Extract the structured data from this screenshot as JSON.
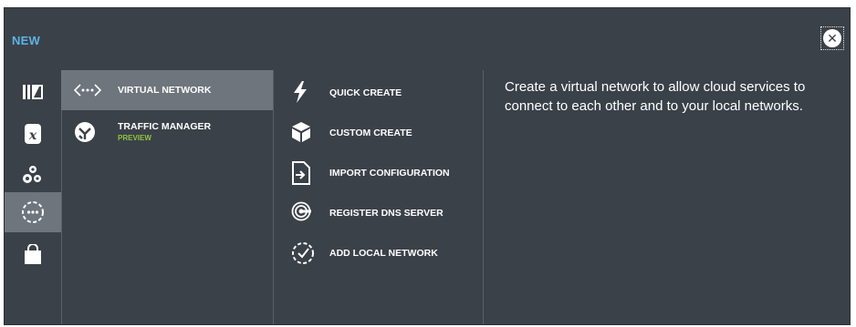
{
  "dialog": {
    "title": "NEW",
    "close_icon": "close-icon",
    "description": "Create a virtual network to allow cloud services to connect to each other and to your local networks."
  },
  "rail": {
    "items": [
      {
        "icon": "sql-database-icon"
      },
      {
        "icon": "storage-table-icon"
      },
      {
        "icon": "gears-icon"
      },
      {
        "icon": "network-services-icon",
        "selected": true
      },
      {
        "icon": "store-bag-icon"
      }
    ]
  },
  "services": [
    {
      "label": "VIRTUAL NETWORK",
      "icon": "virtual-network-icon",
      "selected": true
    },
    {
      "label": "TRAFFIC MANAGER",
      "sublabel": "PREVIEW",
      "icon": "traffic-manager-icon"
    }
  ],
  "actions": [
    {
      "label": "QUICK CREATE",
      "icon": "lightning-icon"
    },
    {
      "label": "CUSTOM CREATE",
      "icon": "cube-icon"
    },
    {
      "label": "IMPORT CONFIGURATION",
      "icon": "import-file-icon"
    },
    {
      "label": "REGISTER DNS SERVER",
      "icon": "dns-server-icon"
    },
    {
      "label": "ADD LOCAL NETWORK",
      "icon": "local-network-icon"
    }
  ],
  "colors": {
    "panel_bg": "#3b4149",
    "selected_bg": "#6f757d",
    "title_accent": "#5ab4e6",
    "preview_green": "#8cc63f"
  }
}
